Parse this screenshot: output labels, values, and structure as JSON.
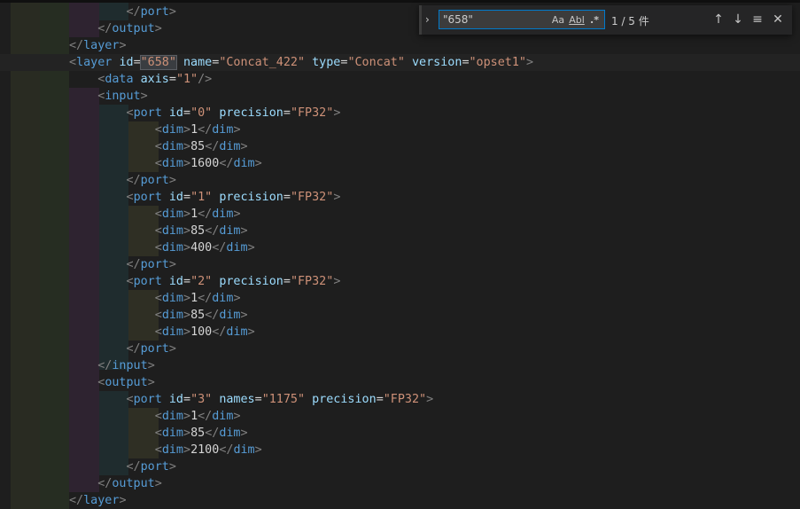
{
  "find_widget": {
    "query": "\"658\"",
    "match_case_label": "Aa",
    "whole_word_label": "Abl",
    "regex_label": ".*",
    "match_count": "1 / 5 件"
  },
  "code_lines": [
    [
      [
        "txt",
        "        "
      ],
      [
        "punct",
        "</"
      ],
      [
        "tag",
        "port"
      ],
      [
        "punct",
        ">"
      ]
    ],
    [
      [
        "txt",
        "    "
      ],
      [
        "punct",
        "</"
      ],
      [
        "tag",
        "output"
      ],
      [
        "punct",
        ">"
      ]
    ],
    [
      [
        "punct",
        "</"
      ],
      [
        "tag",
        "layer"
      ],
      [
        "punct",
        ">"
      ]
    ],
    [
      [
        "punct",
        "<"
      ],
      [
        "tag",
        "layer"
      ],
      [
        "txt",
        " "
      ],
      [
        "attr",
        "id"
      ],
      [
        "eq",
        "="
      ],
      [
        "hl",
        "\"658\""
      ],
      [
        "txt",
        " "
      ],
      [
        "attr",
        "name"
      ],
      [
        "eq",
        "="
      ],
      [
        "str",
        "\"Concat_422\""
      ],
      [
        "txt",
        " "
      ],
      [
        "attr",
        "type"
      ],
      [
        "eq",
        "="
      ],
      [
        "str",
        "\"Concat\""
      ],
      [
        "txt",
        " "
      ],
      [
        "attr",
        "version"
      ],
      [
        "eq",
        "="
      ],
      [
        "str",
        "\"opset1\""
      ],
      [
        "punct",
        ">"
      ]
    ],
    [
      [
        "txt",
        "    "
      ],
      [
        "punct",
        "<"
      ],
      [
        "tag",
        "data"
      ],
      [
        "txt",
        " "
      ],
      [
        "attr",
        "axis"
      ],
      [
        "eq",
        "="
      ],
      [
        "str",
        "\"1\""
      ],
      [
        "punct",
        "/>"
      ]
    ],
    [
      [
        "txt",
        "    "
      ],
      [
        "punct",
        "<"
      ],
      [
        "tag",
        "input"
      ],
      [
        "punct",
        ">"
      ]
    ],
    [
      [
        "txt",
        "        "
      ],
      [
        "punct",
        "<"
      ],
      [
        "tag",
        "port"
      ],
      [
        "txt",
        " "
      ],
      [
        "attr",
        "id"
      ],
      [
        "eq",
        "="
      ],
      [
        "str",
        "\"0\""
      ],
      [
        "txt",
        " "
      ],
      [
        "attr",
        "precision"
      ],
      [
        "eq",
        "="
      ],
      [
        "str",
        "\"FP32\""
      ],
      [
        "punct",
        ">"
      ]
    ],
    [
      [
        "txt",
        "            "
      ],
      [
        "punct",
        "<"
      ],
      [
        "tag",
        "dim"
      ],
      [
        "punct",
        ">"
      ],
      [
        "txt",
        "1"
      ],
      [
        "punct",
        "</"
      ],
      [
        "tag",
        "dim"
      ],
      [
        "punct",
        ">"
      ]
    ],
    [
      [
        "txt",
        "            "
      ],
      [
        "punct",
        "<"
      ],
      [
        "tag",
        "dim"
      ],
      [
        "punct",
        ">"
      ],
      [
        "txt",
        "85"
      ],
      [
        "punct",
        "</"
      ],
      [
        "tag",
        "dim"
      ],
      [
        "punct",
        ">"
      ]
    ],
    [
      [
        "txt",
        "            "
      ],
      [
        "punct",
        "<"
      ],
      [
        "tag",
        "dim"
      ],
      [
        "punct",
        ">"
      ],
      [
        "txt",
        "1600"
      ],
      [
        "punct",
        "</"
      ],
      [
        "tag",
        "dim"
      ],
      [
        "punct",
        ">"
      ]
    ],
    [
      [
        "txt",
        "        "
      ],
      [
        "punct",
        "</"
      ],
      [
        "tag",
        "port"
      ],
      [
        "punct",
        ">"
      ]
    ],
    [
      [
        "txt",
        "        "
      ],
      [
        "punct",
        "<"
      ],
      [
        "tag",
        "port"
      ],
      [
        "txt",
        " "
      ],
      [
        "attr",
        "id"
      ],
      [
        "eq",
        "="
      ],
      [
        "str",
        "\"1\""
      ],
      [
        "txt",
        " "
      ],
      [
        "attr",
        "precision"
      ],
      [
        "eq",
        "="
      ],
      [
        "str",
        "\"FP32\""
      ],
      [
        "punct",
        ">"
      ]
    ],
    [
      [
        "txt",
        "            "
      ],
      [
        "punct",
        "<"
      ],
      [
        "tag",
        "dim"
      ],
      [
        "punct",
        ">"
      ],
      [
        "txt",
        "1"
      ],
      [
        "punct",
        "</"
      ],
      [
        "tag",
        "dim"
      ],
      [
        "punct",
        ">"
      ]
    ],
    [
      [
        "txt",
        "            "
      ],
      [
        "punct",
        "<"
      ],
      [
        "tag",
        "dim"
      ],
      [
        "punct",
        ">"
      ],
      [
        "txt",
        "85"
      ],
      [
        "punct",
        "</"
      ],
      [
        "tag",
        "dim"
      ],
      [
        "punct",
        ">"
      ]
    ],
    [
      [
        "txt",
        "            "
      ],
      [
        "punct",
        "<"
      ],
      [
        "tag",
        "dim"
      ],
      [
        "punct",
        ">"
      ],
      [
        "txt",
        "400"
      ],
      [
        "punct",
        "</"
      ],
      [
        "tag",
        "dim"
      ],
      [
        "punct",
        ">"
      ]
    ],
    [
      [
        "txt",
        "        "
      ],
      [
        "punct",
        "</"
      ],
      [
        "tag",
        "port"
      ],
      [
        "punct",
        ">"
      ]
    ],
    [
      [
        "txt",
        "        "
      ],
      [
        "punct",
        "<"
      ],
      [
        "tag",
        "port"
      ],
      [
        "txt",
        " "
      ],
      [
        "attr",
        "id"
      ],
      [
        "eq",
        "="
      ],
      [
        "str",
        "\"2\""
      ],
      [
        "txt",
        " "
      ],
      [
        "attr",
        "precision"
      ],
      [
        "eq",
        "="
      ],
      [
        "str",
        "\"FP32\""
      ],
      [
        "punct",
        ">"
      ]
    ],
    [
      [
        "txt",
        "            "
      ],
      [
        "punct",
        "<"
      ],
      [
        "tag",
        "dim"
      ],
      [
        "punct",
        ">"
      ],
      [
        "txt",
        "1"
      ],
      [
        "punct",
        "</"
      ],
      [
        "tag",
        "dim"
      ],
      [
        "punct",
        ">"
      ]
    ],
    [
      [
        "txt",
        "            "
      ],
      [
        "punct",
        "<"
      ],
      [
        "tag",
        "dim"
      ],
      [
        "punct",
        ">"
      ],
      [
        "txt",
        "85"
      ],
      [
        "punct",
        "</"
      ],
      [
        "tag",
        "dim"
      ],
      [
        "punct",
        ">"
      ]
    ],
    [
      [
        "txt",
        "            "
      ],
      [
        "punct",
        "<"
      ],
      [
        "tag",
        "dim"
      ],
      [
        "punct",
        ">"
      ],
      [
        "txt",
        "100"
      ],
      [
        "punct",
        "</"
      ],
      [
        "tag",
        "dim"
      ],
      [
        "punct",
        ">"
      ]
    ],
    [
      [
        "txt",
        "        "
      ],
      [
        "punct",
        "</"
      ],
      [
        "tag",
        "port"
      ],
      [
        "punct",
        ">"
      ]
    ],
    [
      [
        "txt",
        "    "
      ],
      [
        "punct",
        "</"
      ],
      [
        "tag",
        "input"
      ],
      [
        "punct",
        ">"
      ]
    ],
    [
      [
        "txt",
        "    "
      ],
      [
        "punct",
        "<"
      ],
      [
        "tag",
        "output"
      ],
      [
        "punct",
        ">"
      ]
    ],
    [
      [
        "txt",
        "        "
      ],
      [
        "punct",
        "<"
      ],
      [
        "tag",
        "port"
      ],
      [
        "txt",
        " "
      ],
      [
        "attr",
        "id"
      ],
      [
        "eq",
        "="
      ],
      [
        "str",
        "\"3\""
      ],
      [
        "txt",
        " "
      ],
      [
        "attr",
        "names"
      ],
      [
        "eq",
        "="
      ],
      [
        "str",
        "\"1175\""
      ],
      [
        "txt",
        " "
      ],
      [
        "attr",
        "precision"
      ],
      [
        "eq",
        "="
      ],
      [
        "str",
        "\"FP32\""
      ],
      [
        "punct",
        ">"
      ]
    ],
    [
      [
        "txt",
        "            "
      ],
      [
        "punct",
        "<"
      ],
      [
        "tag",
        "dim"
      ],
      [
        "punct",
        ">"
      ],
      [
        "txt",
        "1"
      ],
      [
        "punct",
        "</"
      ],
      [
        "tag",
        "dim"
      ],
      [
        "punct",
        ">"
      ]
    ],
    [
      [
        "txt",
        "            "
      ],
      [
        "punct",
        "<"
      ],
      [
        "tag",
        "dim"
      ],
      [
        "punct",
        ">"
      ],
      [
        "txt",
        "85"
      ],
      [
        "punct",
        "</"
      ],
      [
        "tag",
        "dim"
      ],
      [
        "punct",
        ">"
      ]
    ],
    [
      [
        "txt",
        "            "
      ],
      [
        "punct",
        "<"
      ],
      [
        "tag",
        "dim"
      ],
      [
        "punct",
        ">"
      ],
      [
        "txt",
        "2100"
      ],
      [
        "punct",
        "</"
      ],
      [
        "tag",
        "dim"
      ],
      [
        "punct",
        ">"
      ]
    ],
    [
      [
        "txt",
        "        "
      ],
      [
        "punct",
        "</"
      ],
      [
        "tag",
        "port"
      ],
      [
        "punct",
        ">"
      ]
    ],
    [
      [
        "txt",
        "    "
      ],
      [
        "punct",
        "</"
      ],
      [
        "tag",
        "output"
      ],
      [
        "punct",
        ">"
      ]
    ],
    [
      [
        "punct",
        "</"
      ],
      [
        "tag",
        "layer"
      ],
      [
        "punct",
        ">"
      ]
    ]
  ]
}
